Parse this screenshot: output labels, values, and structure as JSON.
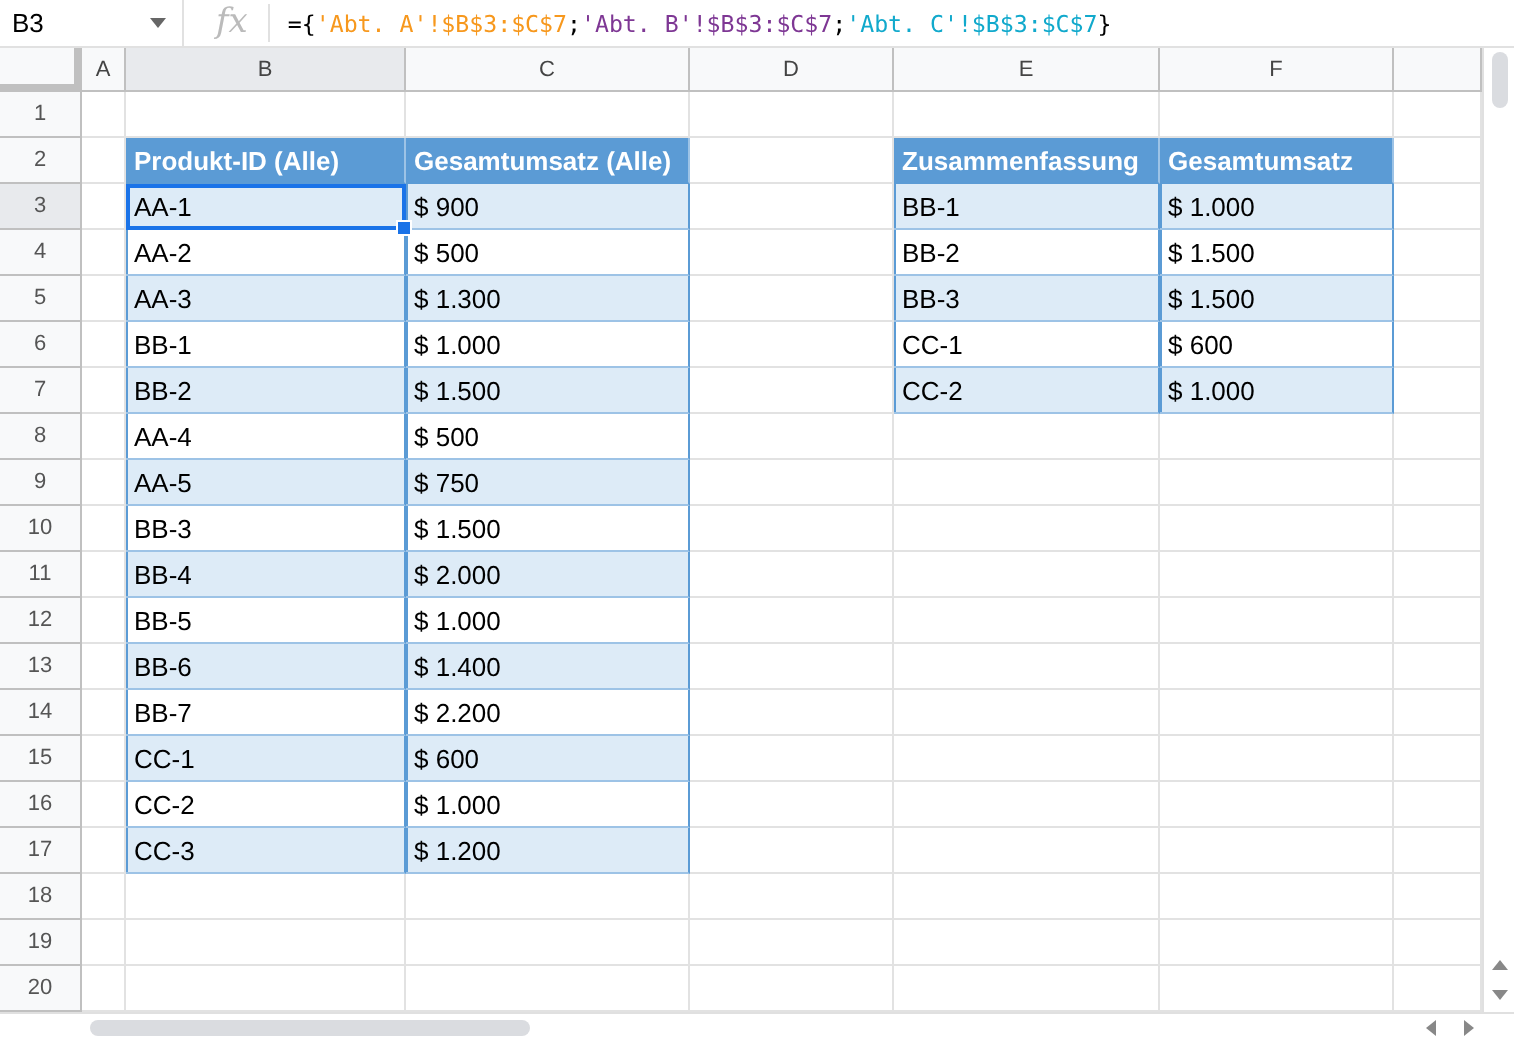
{
  "name_box": "B3",
  "fx_label": "fx",
  "formula": [
    {
      "text": "={",
      "color": "#000000"
    },
    {
      "text": "'Abt. A'!$B$3:$C$7",
      "color": "#f7981d"
    },
    {
      "text": ";",
      "color": "#000000"
    },
    {
      "text": "'Abt. B'!$B$3:$C$7",
      "color": "#7e3794"
    },
    {
      "text": ";",
      "color": "#000000"
    },
    {
      "text": "'Abt. C'!$B$3:$C$7",
      "color": "#11a9cc"
    },
    {
      "text": "}",
      "color": "#000000"
    }
  ],
  "column_headers": [
    "A",
    "B",
    "C",
    "D",
    "E",
    "F"
  ],
  "row_headers": [
    "1",
    "2",
    "3",
    "4",
    "5",
    "6",
    "7",
    "8",
    "9",
    "10",
    "11",
    "12",
    "13",
    "14",
    "15",
    "16",
    "17",
    "18",
    "19",
    "20"
  ],
  "left_table": {
    "columns": [
      "Produkt-ID (Alle)",
      "Gesamtumsatz (Alle)"
    ],
    "rows": [
      {
        "cells": [
          "AA-1",
          "$ 900"
        ],
        "selected": true
      },
      {
        "cells": [
          "AA-2",
          "$ 500"
        ],
        "selected": false
      },
      {
        "cells": [
          "AA-3",
          "$ 1.300"
        ],
        "selected": false
      },
      {
        "cells": [
          "BB-1",
          "$ 1.000"
        ],
        "selected": false
      },
      {
        "cells": [
          "BB-2",
          "$ 1.500"
        ],
        "selected": false
      },
      {
        "cells": [
          "AA-4",
          "$ 500"
        ],
        "selected": false
      },
      {
        "cells": [
          "AA-5",
          "$ 750"
        ],
        "selected": false
      },
      {
        "cells": [
          "BB-3",
          "$ 1.500"
        ],
        "selected": false
      },
      {
        "cells": [
          "BB-4",
          "$ 2.000"
        ],
        "selected": false
      },
      {
        "cells": [
          "BB-5",
          "$ 1.000"
        ],
        "selected": false
      },
      {
        "cells": [
          "BB-6",
          "$ 1.400"
        ],
        "selected": false
      },
      {
        "cells": [
          "BB-7",
          "$ 2.200"
        ],
        "selected": false
      },
      {
        "cells": [
          "CC-1",
          "$ 600"
        ],
        "selected": false
      },
      {
        "cells": [
          "CC-2",
          "$ 1.000"
        ],
        "selected": false
      },
      {
        "cells": [
          "CC-3",
          "$ 1.200"
        ],
        "selected": false
      }
    ]
  },
  "summary_table": {
    "columns": [
      "Zusammenfassung",
      "Gesamtumsatz"
    ],
    "rows": [
      {
        "cells": [
          "BB-1",
          "$ 1.000"
        ],
        "selected": false
      },
      {
        "cells": [
          "BB-2",
          "$ 1.500"
        ],
        "selected": false
      },
      {
        "cells": [
          "BB-3",
          "$ 1.500"
        ],
        "selected": false
      },
      {
        "cells": [
          "CC-1",
          "$ 600"
        ],
        "selected": false
      },
      {
        "cells": [
          "CC-2",
          "$ 1.000"
        ],
        "selected": false
      }
    ]
  }
}
